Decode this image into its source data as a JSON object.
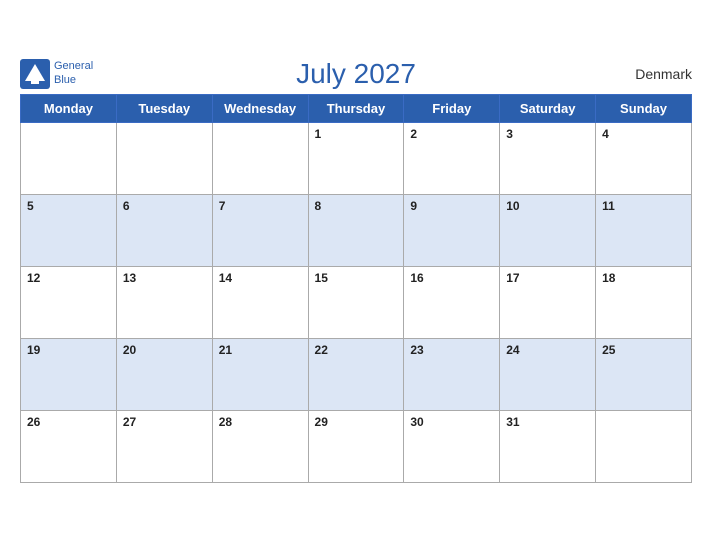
{
  "header": {
    "logo_line1": "General",
    "logo_line2": "Blue",
    "title": "July 2027",
    "country": "Denmark"
  },
  "weekdays": [
    "Monday",
    "Tuesday",
    "Wednesday",
    "Thursday",
    "Friday",
    "Saturday",
    "Sunday"
  ],
  "weeks": [
    [
      {
        "num": "",
        "empty": true
      },
      {
        "num": "",
        "empty": true
      },
      {
        "num": "",
        "empty": true
      },
      {
        "num": "1",
        "empty": false
      },
      {
        "num": "2",
        "empty": false
      },
      {
        "num": "3",
        "empty": false
      },
      {
        "num": "4",
        "empty": false
      }
    ],
    [
      {
        "num": "5",
        "empty": false
      },
      {
        "num": "6",
        "empty": false
      },
      {
        "num": "7",
        "empty": false
      },
      {
        "num": "8",
        "empty": false
      },
      {
        "num": "9",
        "empty": false
      },
      {
        "num": "10",
        "empty": false
      },
      {
        "num": "11",
        "empty": false
      }
    ],
    [
      {
        "num": "12",
        "empty": false
      },
      {
        "num": "13",
        "empty": false
      },
      {
        "num": "14",
        "empty": false
      },
      {
        "num": "15",
        "empty": false
      },
      {
        "num": "16",
        "empty": false
      },
      {
        "num": "17",
        "empty": false
      },
      {
        "num": "18",
        "empty": false
      }
    ],
    [
      {
        "num": "19",
        "empty": false
      },
      {
        "num": "20",
        "empty": false
      },
      {
        "num": "21",
        "empty": false
      },
      {
        "num": "22",
        "empty": false
      },
      {
        "num": "23",
        "empty": false
      },
      {
        "num": "24",
        "empty": false
      },
      {
        "num": "25",
        "empty": false
      }
    ],
    [
      {
        "num": "26",
        "empty": false
      },
      {
        "num": "27",
        "empty": false
      },
      {
        "num": "28",
        "empty": false
      },
      {
        "num": "29",
        "empty": false
      },
      {
        "num": "30",
        "empty": false
      },
      {
        "num": "31",
        "empty": false
      },
      {
        "num": "",
        "empty": true
      }
    ]
  ],
  "dark_rows": [
    1,
    3
  ]
}
